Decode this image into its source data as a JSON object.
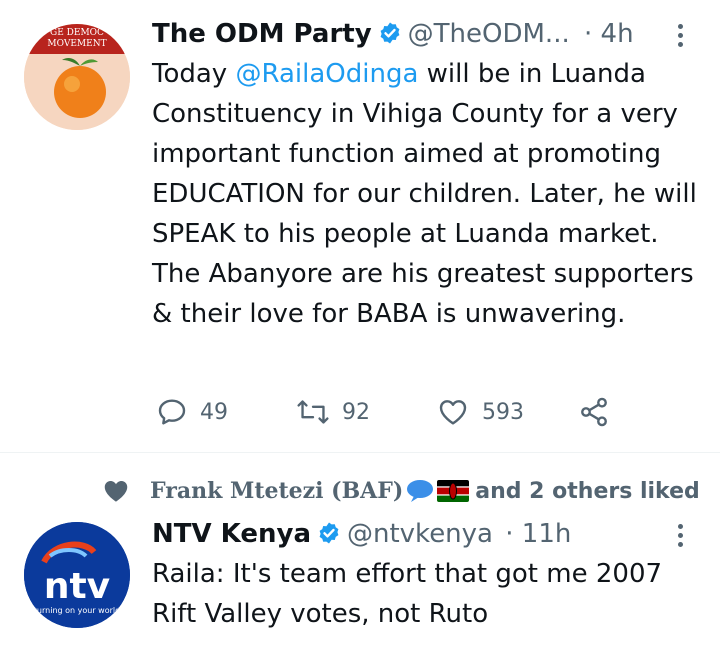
{
  "tweet1": {
    "avatar_text": "GE DEMOC MOVEMENT",
    "name": "The ODM Party",
    "handle": "@TheODM...",
    "time": "· 4h",
    "text_before": "Today ",
    "mention": "@RailaOdinga",
    "text_after": " will be in Luanda Constituency in Vihiga County for a very important function aimed at promoting EDUCATION for our children. Later, he will SPEAK to his people at Luanda market. The Abanyore are his greatest supporters & their love for BABA is unwavering.",
    "replies": "49",
    "retweets": "92",
    "likes": "593"
  },
  "social_context": {
    "liker": "Frank Mtetezi (BAF)",
    "suffix": "and 2 others liked"
  },
  "tweet2": {
    "avatar_text": "ntv",
    "avatar_tagline": "turning on your world",
    "name": "NTV Kenya",
    "handle": "@ntvkenya",
    "time": "· 11h",
    "text": "Raila: It's team effort that got me 2007 Rift Valley votes, not Ruto"
  },
  "colors": {
    "accent": "#1d9bf0",
    "muted": "#536471",
    "text": "#0f1419"
  },
  "icons": [
    "verified-badge-icon",
    "more-icon",
    "reply-icon",
    "retweet-icon",
    "like-icon",
    "share-icon",
    "heart-icon",
    "speech-bubble-emoji",
    "kenya-flag-emoji"
  ]
}
